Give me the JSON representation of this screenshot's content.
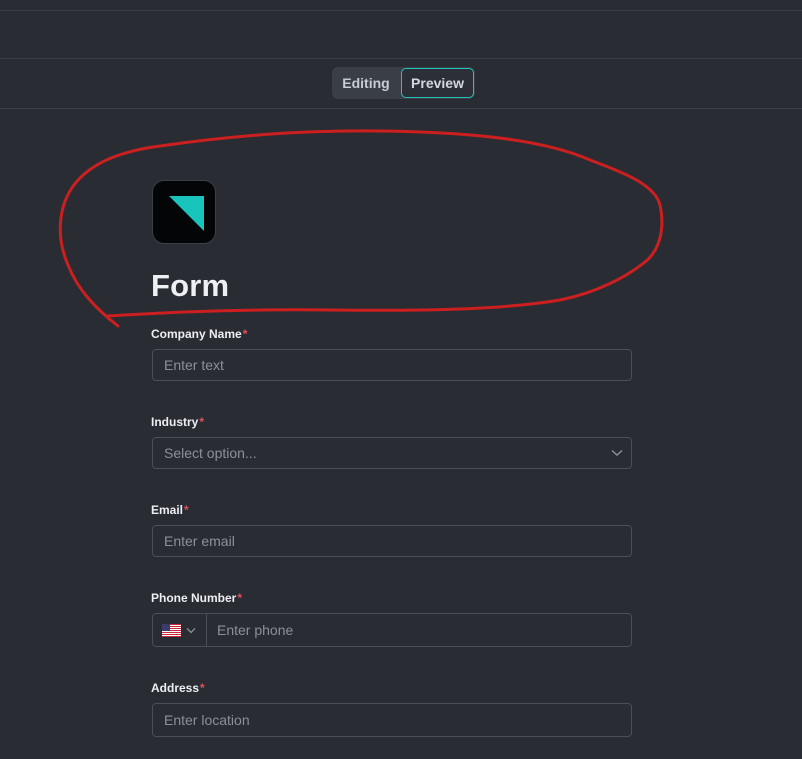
{
  "toolbar": {
    "editing_label": "Editing",
    "preview_label": "Preview",
    "active_mode": "Preview"
  },
  "form": {
    "title": "Form",
    "required_marker": "*",
    "fields": {
      "company_name": {
        "label": "Company Name",
        "placeholder": "Enter text"
      },
      "industry": {
        "label": "Industry",
        "placeholder": "Select option..."
      },
      "email": {
        "label": "Email",
        "placeholder": "Enter email"
      },
      "phone": {
        "label": "Phone Number",
        "placeholder": "Enter phone",
        "country_flag": "us-flag-icon"
      },
      "address": {
        "label": "Address",
        "placeholder": "Enter location"
      }
    }
  },
  "colors": {
    "accent": "#23c2bc",
    "required": "#e0505a",
    "annotation": "#cc1f1f",
    "background": "#2a2c33"
  }
}
